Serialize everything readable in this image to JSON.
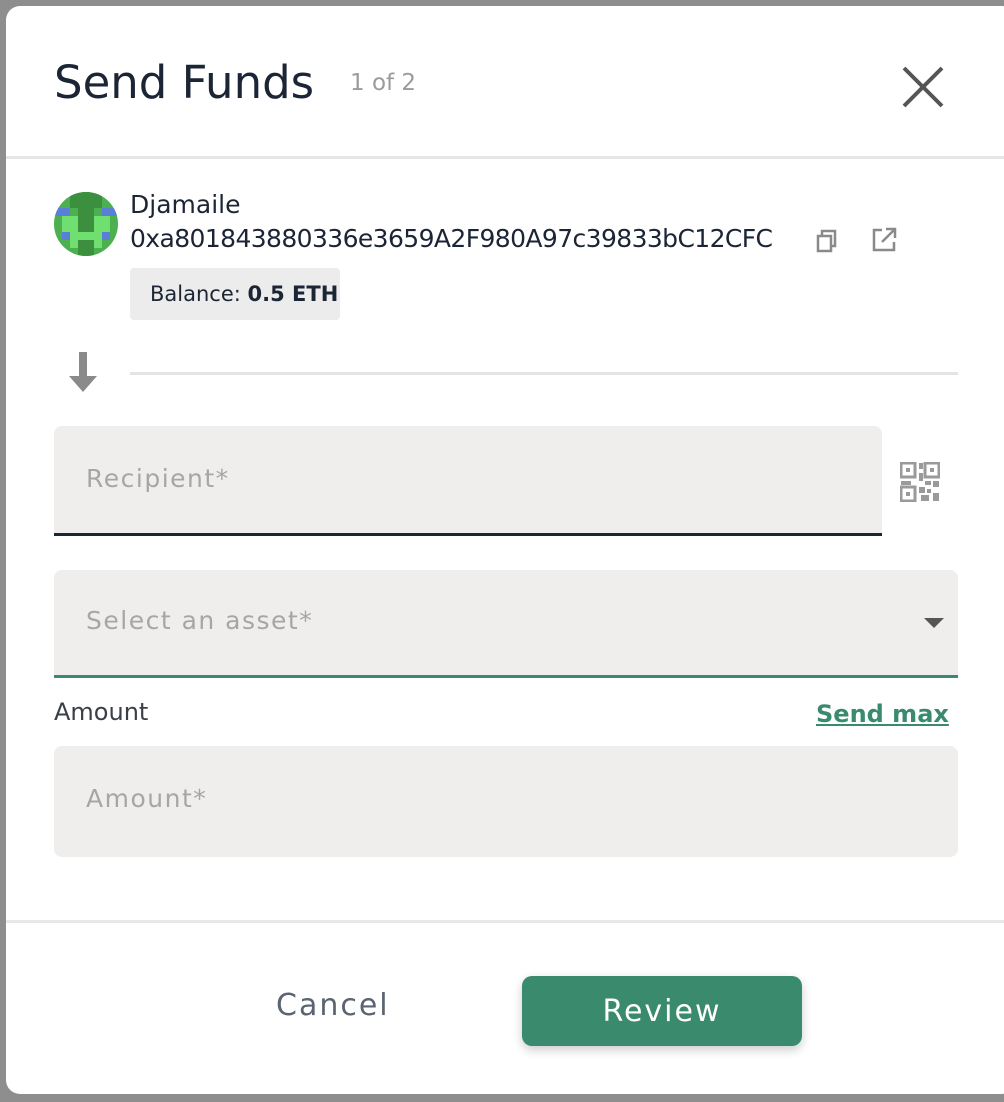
{
  "modal": {
    "title": "Send Funds",
    "step": "1 of 2"
  },
  "account": {
    "name": "Djamaile",
    "address": "0xa801843880336e3659A2F980A97c39833bC12CFC",
    "balance_label": "Balance:",
    "balance_value": "0.5 ETH"
  },
  "form": {
    "recipient_placeholder": "Recipient*",
    "asset_placeholder": "Select an asset*",
    "amount_label": "Amount",
    "send_max_label": "Send max",
    "amount_placeholder": "Amount*"
  },
  "footer": {
    "cancel_label": "Cancel",
    "review_label": "Review"
  },
  "colors": {
    "accent": "#3a8a6e",
    "text_dark": "#1b2535",
    "field_bg": "#efeeed"
  },
  "icons": [
    "close-icon",
    "copy-icon",
    "external-link-icon",
    "arrow-down-icon",
    "qr-code-icon",
    "chevron-down-icon"
  ]
}
